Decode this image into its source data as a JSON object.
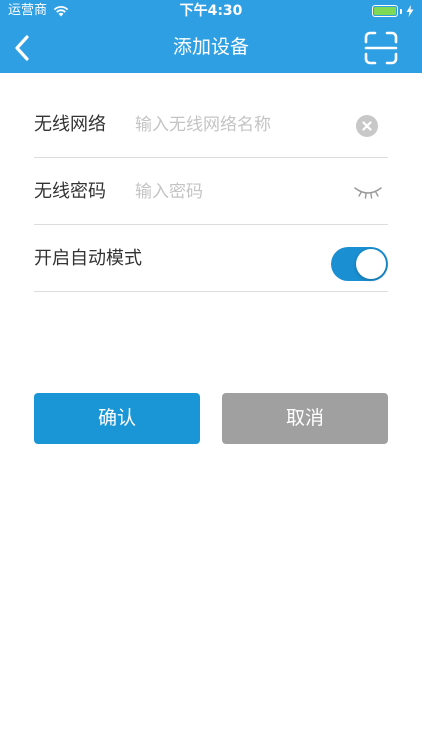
{
  "status_bar": {
    "carrier": "运营商",
    "time": "下午4:30",
    "battery_color": "#7ed957"
  },
  "nav": {
    "title": "添加设备",
    "back_icon": "chevron-left-icon",
    "scan_icon": "scan-icon",
    "bar_color": "#2f9fe3"
  },
  "form": {
    "wifi": {
      "label": "无线网络",
      "placeholder": "输入无线网络名称",
      "value": ""
    },
    "password": {
      "label": "无线密码",
      "placeholder": "输入密码",
      "value": ""
    },
    "auto_mode": {
      "label": "开启自动模式",
      "enabled": true
    }
  },
  "buttons": {
    "confirm": "确认",
    "cancel": "取消"
  }
}
